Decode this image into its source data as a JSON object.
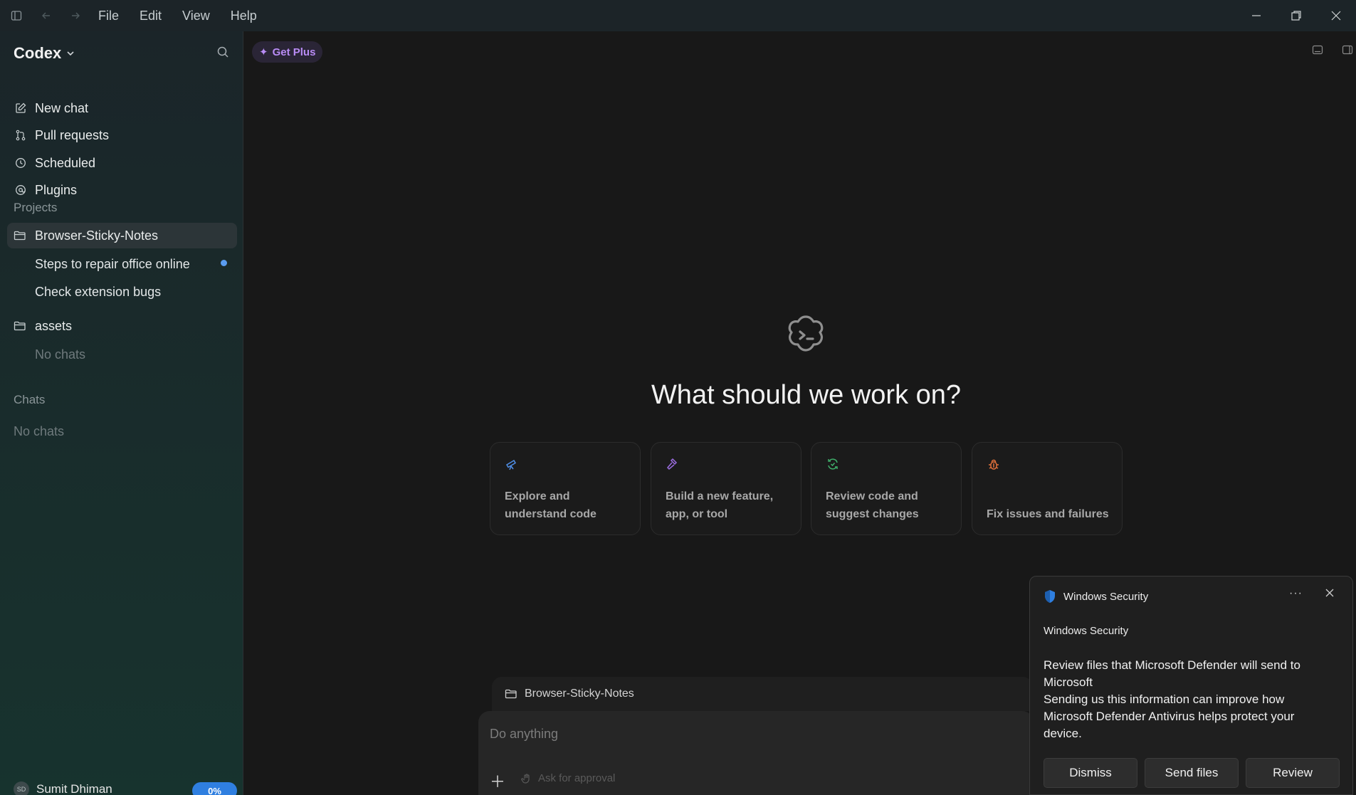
{
  "menu": [
    "File",
    "Edit",
    "View",
    "Help"
  ],
  "sidebar": {
    "brand": "Codex",
    "nav": [
      {
        "label": "New chat",
        "icon": "compose-icon"
      },
      {
        "label": "Pull requests",
        "icon": "pull-request-icon"
      },
      {
        "label": "Scheduled",
        "icon": "clock-icon"
      },
      {
        "label": "Plugins",
        "icon": "plugin-icon"
      }
    ],
    "projects_label": "Projects",
    "projects": [
      {
        "name": "Browser-Sticky-Notes",
        "chats": [
          "Steps to repair office online",
          "Check extension bugs"
        ]
      },
      {
        "name": "assets",
        "empty": "No chats"
      }
    ],
    "chats_label": "Chats",
    "chats_empty": "No chats",
    "user": {
      "name": "Sumit Dhiman",
      "initials": "SD"
    },
    "usage": "0%"
  },
  "main": {
    "get_plus": "Get Plus",
    "title": "What should we work on?",
    "cards": [
      {
        "label": "Explore and understand code",
        "icon": "telescope-icon",
        "color": "#4f8fe8"
      },
      {
        "label": "Build a new feature, app, or tool",
        "icon": "hammer-icon",
        "color": "#9b6de0"
      },
      {
        "label": "Review code and suggest changes",
        "icon": "refresh-check-icon",
        "color": "#3fae6a"
      },
      {
        "label": "Fix issues and failures",
        "icon": "bug-icon",
        "color": "#e0703a"
      }
    ],
    "composer": {
      "project": "Browser-Sticky-Notes",
      "placeholder": "Do anything",
      "approval": "Ask for approval"
    }
  },
  "toast": {
    "source": "Windows Security",
    "app": "Windows Security",
    "title": "Review files that Microsoft Defender will send to Microsoft",
    "body": "Sending us this information can improve how Microsoft Defender Antivirus helps protect your device.",
    "buttons": [
      "Dismiss",
      "Send files",
      "Review"
    ]
  }
}
